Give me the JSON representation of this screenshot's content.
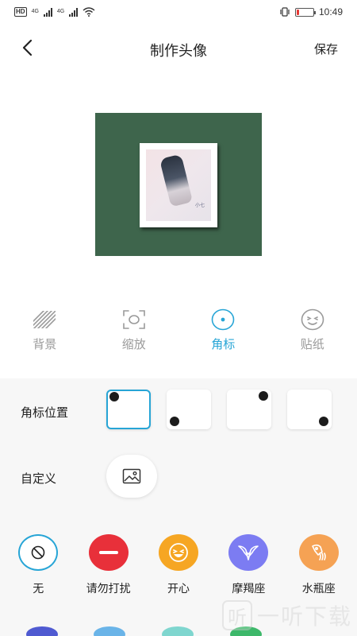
{
  "status_bar": {
    "network_badge": "HD",
    "network_1": "4G",
    "network_2": "4G",
    "time": "10:49",
    "battery_level": 0.15,
    "battery_color": "#e53935",
    "icons": [
      "hd-icon",
      "signal-icon",
      "signal-icon",
      "wifi-icon",
      "vibrate-icon",
      "battery-icon"
    ]
  },
  "header": {
    "title": "制作头像",
    "save_label": "保存",
    "back_icon": "chevron-left-icon"
  },
  "preview": {
    "background_color": "#3e654c",
    "photo_signature": "小七"
  },
  "tabs": [
    {
      "label": "背景",
      "icon": "hatch-icon",
      "active": false
    },
    {
      "label": "缩放",
      "icon": "scale-frame-icon",
      "active": false
    },
    {
      "label": "角标",
      "icon": "dot-circle-icon",
      "active": true
    },
    {
      "label": "贴纸",
      "icon": "smiley-icon",
      "active": false
    }
  ],
  "accent_color": "#27a5d6",
  "panel": {
    "position_label": "角标位置",
    "position_options": [
      "top-left",
      "bottom-left",
      "top-right",
      "bottom-right"
    ],
    "selected_position": "top-left",
    "custom_label": "自定义",
    "custom_icon": "image-icon",
    "badges": [
      {
        "label": "无",
        "icon": "no-icon",
        "color": "#ffffff"
      },
      {
        "label": "请勿打扰",
        "icon": "minus-icon",
        "color": "#e8303a"
      },
      {
        "label": "开心",
        "icon": "laughing-face-icon",
        "color": "#f6a623"
      },
      {
        "label": "摩羯座",
        "icon": "capricorn-icon",
        "color": "#7c7cf2"
      },
      {
        "label": "水瓶座",
        "icon": "aquarius-icon",
        "color": "#f5a254"
      }
    ]
  },
  "watermark": {
    "box_text": "听",
    "text": "一听下载"
  }
}
